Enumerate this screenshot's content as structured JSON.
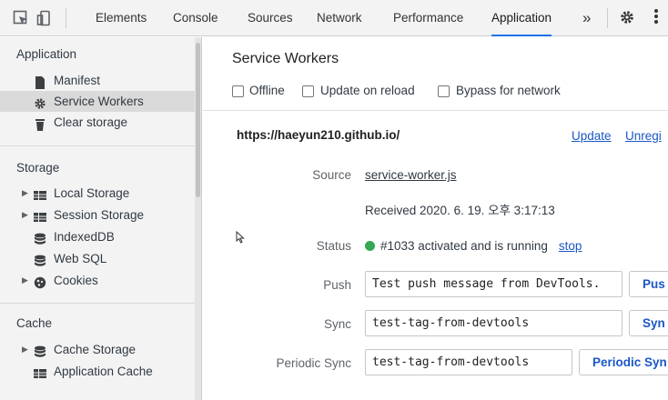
{
  "toolbar": {
    "icons": [
      "inspect-element-icon",
      "device-toolbar-icon",
      "settings-gear-icon",
      "more-options-icon"
    ],
    "tabs": [
      {
        "label": "Elements",
        "active": false
      },
      {
        "label": "Console",
        "active": false
      },
      {
        "label": "Sources",
        "active": false
      },
      {
        "label": "Network",
        "active": false
      },
      {
        "label": "Performance",
        "active": false
      },
      {
        "label": "Application",
        "active": true
      }
    ],
    "overflow_label": "»"
  },
  "sidebar": {
    "application": {
      "title": "Application",
      "items": [
        {
          "label": "Manifest",
          "icon": "document-icon"
        },
        {
          "label": "Service Workers",
          "icon": "gear-icon",
          "selected": true
        },
        {
          "label": "Clear storage",
          "icon": "trash-icon"
        }
      ]
    },
    "storage": {
      "title": "Storage",
      "items": [
        {
          "label": "Local Storage",
          "icon": "grid-icon",
          "expandable": true
        },
        {
          "label": "Session Storage",
          "icon": "grid-icon",
          "expandable": true
        },
        {
          "label": "IndexedDB",
          "icon": "database-icon"
        },
        {
          "label": "Web SQL",
          "icon": "database-icon"
        },
        {
          "label": "Cookies",
          "icon": "cookie-icon",
          "expandable": true
        }
      ]
    },
    "cache": {
      "title": "Cache",
      "items": [
        {
          "label": "Cache Storage",
          "icon": "database-icon",
          "expandable": true
        },
        {
          "label": "Application Cache",
          "icon": "grid-icon"
        }
      ]
    }
  },
  "main": {
    "title": "Service Workers",
    "checkboxes": [
      {
        "label": "Offline",
        "checked": false
      },
      {
        "label": "Update on reload",
        "checked": false
      },
      {
        "label": "Bypass for network",
        "checked": false
      }
    ],
    "origin": "https://haeyun210.github.io/",
    "update_link": "Update",
    "unregister_link": "Unregi",
    "source": {
      "label": "Source",
      "link": "service-worker.js"
    },
    "received": "Received 2020. 6. 19. 오후 3:17:13",
    "status": {
      "label": "Status",
      "text": "#1033 activated and is running",
      "stop_link": "stop",
      "color": "#34a853"
    },
    "push": {
      "label": "Push",
      "value": "Test push message from DevTools.",
      "button": "Pus"
    },
    "sync": {
      "label": "Sync",
      "value": "test-tag-from-devtools",
      "button": "Syn"
    },
    "periodic_sync": {
      "label": "Periodic Sync",
      "value": "test-tag-from-devtools",
      "button": "Periodic Syn"
    }
  },
  "colors": {
    "accent": "#1a73e8",
    "link": "#1a57c6",
    "selected_bg": "#dadada"
  }
}
